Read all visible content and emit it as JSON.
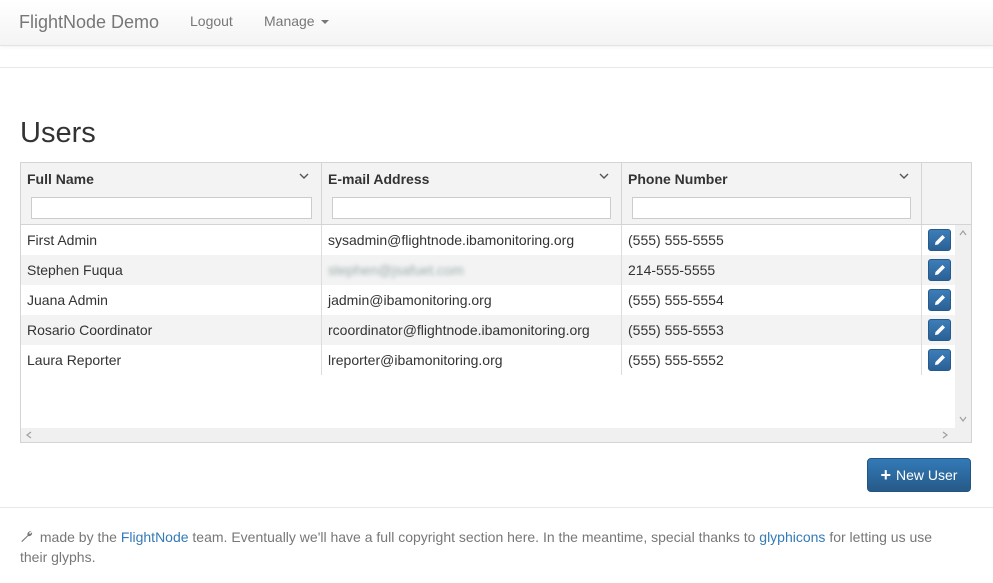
{
  "navbar": {
    "brand": "FlightNode Demo",
    "logout": "Logout",
    "manage": "Manage"
  },
  "page": {
    "title": "Users"
  },
  "grid": {
    "columns": [
      {
        "label": "Full Name"
      },
      {
        "label": "E-mail Address"
      },
      {
        "label": "Phone Number"
      }
    ],
    "filters": [
      "",
      "",
      ""
    ],
    "rows": [
      {
        "name": "First Admin",
        "email": "sysadmin@flightnode.ibamonitoring.org",
        "phone": "(555) 555-5555"
      },
      {
        "name": "Stephen Fuqua",
        "email": "stephen@jsafuet.com",
        "phone": "214-555-5555"
      },
      {
        "name": "Juana Admin",
        "email": "jadmin@ibamonitoring.org",
        "phone": "(555) 555-5554"
      },
      {
        "name": "Rosario Coordinator",
        "email": "rcoordinator@flightnode.ibamonitoring.org",
        "phone": "(555) 555-5553"
      },
      {
        "name": "Laura Reporter",
        "email": "lreporter@ibamonitoring.org",
        "phone": "(555) 555-5552"
      }
    ]
  },
  "actions": {
    "new_user": "New User"
  },
  "footer": {
    "text1": " made by the ",
    "link1": "FlightNode",
    "text2": " team. Eventually we'll have a full copyright section here. In the meantime, special thanks to ",
    "link2": "glyphicons",
    "text3": " for letting us use their glyphs."
  },
  "icons": {
    "sort": "chevron-down-icon",
    "edit": "pencil-icon",
    "add": "plus-icon",
    "footer": "wrench-icon"
  },
  "colors": {
    "primary": "#337ab7",
    "navbar_text": "#777777",
    "alt_row": "#f3f3f3"
  }
}
